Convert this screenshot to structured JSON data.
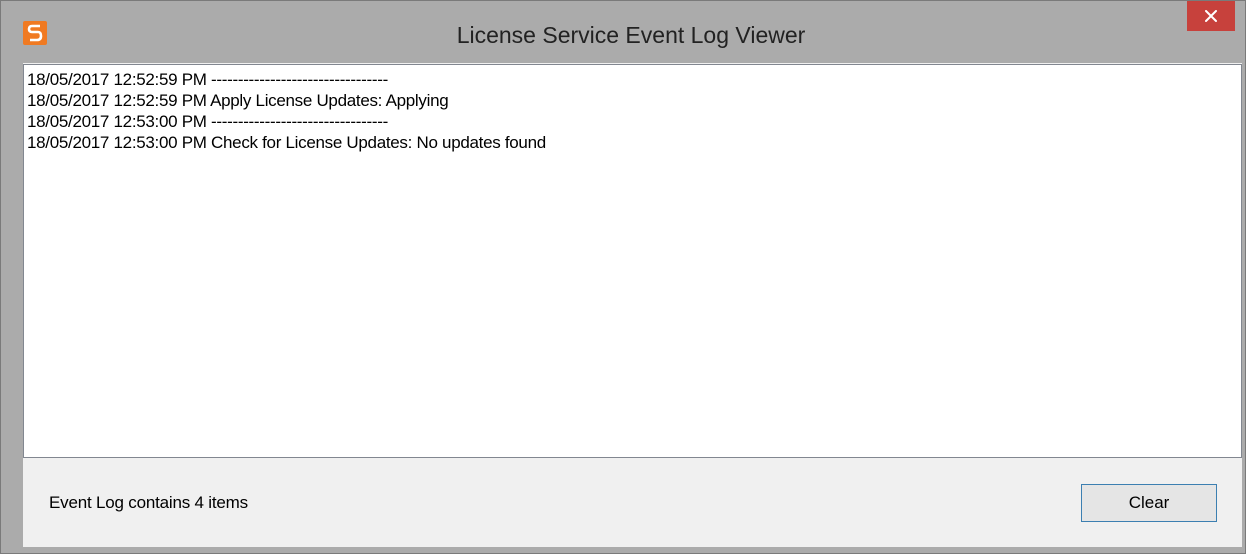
{
  "window": {
    "title": "License Service Event Log Viewer",
    "close_glyph": "✕"
  },
  "log": {
    "entries": [
      "18/05/2017 12:52:59 PM ---------------------------------",
      "18/05/2017 12:52:59 PM Apply License Updates: Applying",
      "18/05/2017 12:53:00 PM ---------------------------------",
      "18/05/2017 12:53:00 PM Check for License Updates: No updates found"
    ]
  },
  "status": {
    "text": "Event Log contains 4 items"
  },
  "actions": {
    "clear_label": "Clear"
  },
  "colors": {
    "app_icon": "#f07a22",
    "close_button": "#c7413c",
    "button_border": "#3c7fb1"
  }
}
